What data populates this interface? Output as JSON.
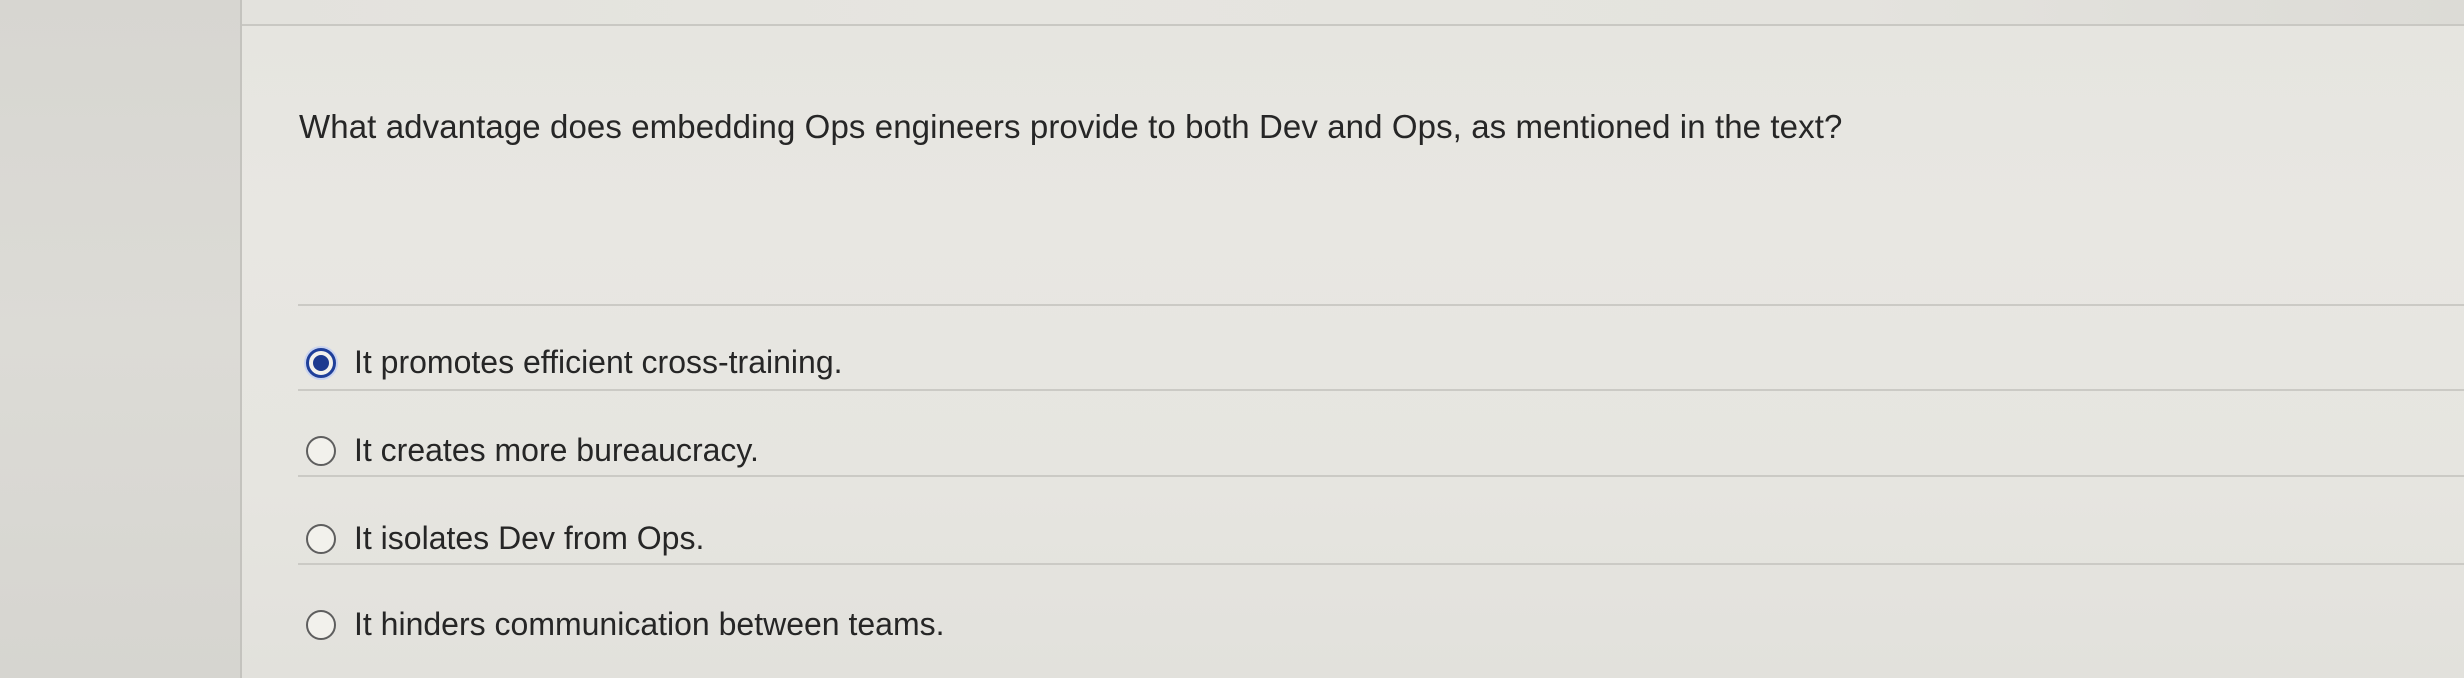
{
  "question": {
    "text": "What advantage does embedding Ops engineers provide to both Dev and Ops, as mentioned in the text?"
  },
  "options": [
    {
      "label": "It promotes efficient cross-training.",
      "selected": true
    },
    {
      "label": "It creates more bureaucracy.",
      "selected": false
    },
    {
      "label": "It isolates Dev from Ops.",
      "selected": false
    },
    {
      "label": "It hinders communication between teams.",
      "selected": false
    }
  ],
  "colors": {
    "selected_radio": "#1d3a8f",
    "background": "#e6e5e0",
    "text": "#262626"
  }
}
